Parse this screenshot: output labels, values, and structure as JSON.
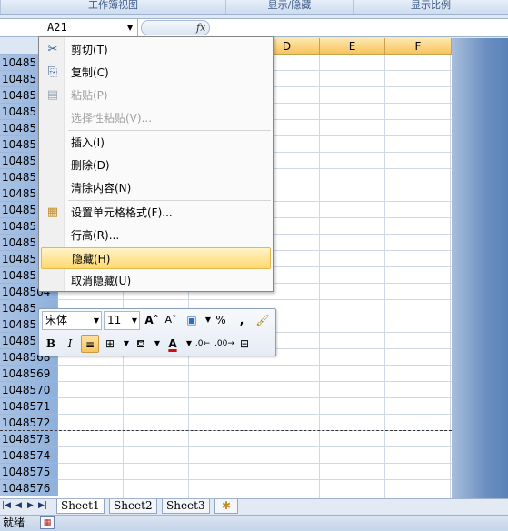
{
  "ribbon": {
    "groups": [
      "工作簿视图",
      "显示/隐藏",
      "显示比例"
    ]
  },
  "formula_bar": {
    "name_box": "A21",
    "fx_label": "fx"
  },
  "columns": [
    "D",
    "E",
    "F"
  ],
  "rows": [
    "10485",
    "10485",
    "10485",
    "10485",
    "10485",
    "10485",
    "10485",
    "10485",
    "10485",
    "10485",
    "10485",
    "10485",
    "10485",
    "10485",
    "1048564",
    "10485",
    "10485",
    "10485",
    "1048568",
    "1048569",
    "1048570",
    "1048571",
    "1048572",
    "1048573",
    "1048574",
    "1048575",
    "1048576"
  ],
  "context_menu": {
    "items": [
      {
        "label": "剪切(T)",
        "icon": "scissors-icon",
        "glyph": "✂",
        "disabled": false
      },
      {
        "label": "复制(C)",
        "icon": "copy-icon",
        "glyph": "⎘",
        "disabled": false
      },
      {
        "label": "粘贴(P)",
        "icon": "paste-icon",
        "glyph": "📋",
        "disabled": true
      },
      {
        "label": "选择性粘贴(V)...",
        "icon": "",
        "glyph": "",
        "disabled": true
      },
      {
        "label": "插入(I)",
        "icon": "",
        "glyph": "",
        "disabled": false
      },
      {
        "label": "删除(D)",
        "icon": "",
        "glyph": "",
        "disabled": false
      },
      {
        "label": "清除内容(N)",
        "icon": "",
        "glyph": "",
        "disabled": false
      },
      {
        "label": "设置单元格格式(F)...",
        "icon": "format-cells-icon",
        "glyph": "▦",
        "disabled": false
      },
      {
        "label": "行高(R)...",
        "icon": "",
        "glyph": "",
        "disabled": false
      },
      {
        "label": "隐藏(H)",
        "icon": "",
        "glyph": "",
        "disabled": false,
        "highlighted": true
      },
      {
        "label": "取消隐藏(U)",
        "icon": "",
        "glyph": "",
        "disabled": false
      }
    ]
  },
  "mini_toolbar": {
    "font_name": "宋体",
    "font_size": "11",
    "percent": "%",
    "comma": ",",
    "bold": "B",
    "italic": "I"
  },
  "sheet_tabs": [
    "Sheet1",
    "Sheet2",
    "Sheet3"
  ],
  "status": {
    "text": "就绪"
  }
}
